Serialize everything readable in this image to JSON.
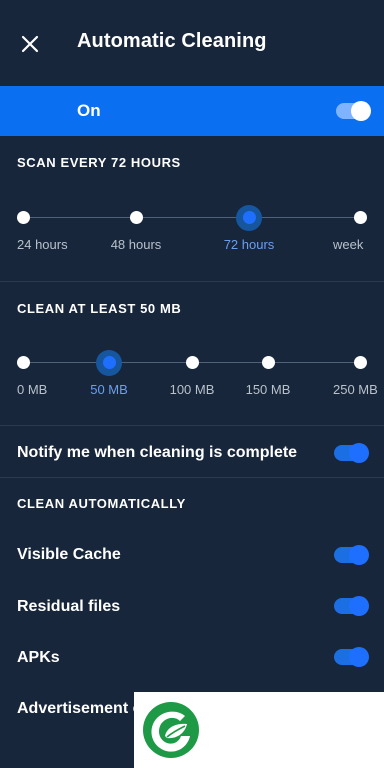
{
  "header": {
    "title": "Automatic Cleaning"
  },
  "master_toggle": {
    "label": "On",
    "state": "on"
  },
  "scan": {
    "heading": "SCAN EVERY 72 HOURS",
    "options": [
      "24 hours",
      "48 hours",
      "72 hours",
      "week"
    ],
    "selected_index": 2
  },
  "clean": {
    "heading": "CLEAN AT LEAST 50 MB",
    "options": [
      "0 MB",
      "50 MB",
      "100 MB",
      "150 MB",
      "250 MB"
    ],
    "selected_index": 1
  },
  "notify": {
    "label": "Notify me when cleaning is complete",
    "state": "on"
  },
  "auto": {
    "heading": "CLEAN AUTOMATICALLY",
    "items": [
      {
        "label": "Visible Cache",
        "state": "on"
      },
      {
        "label": "Residual files",
        "state": "on"
      },
      {
        "label": "APKs",
        "state": "on"
      },
      {
        "label": "Advertisement c"
      }
    ]
  },
  "colors": {
    "accent": "#0a6ff0",
    "background": "#17263a",
    "logo_green": "#1e9a47"
  }
}
